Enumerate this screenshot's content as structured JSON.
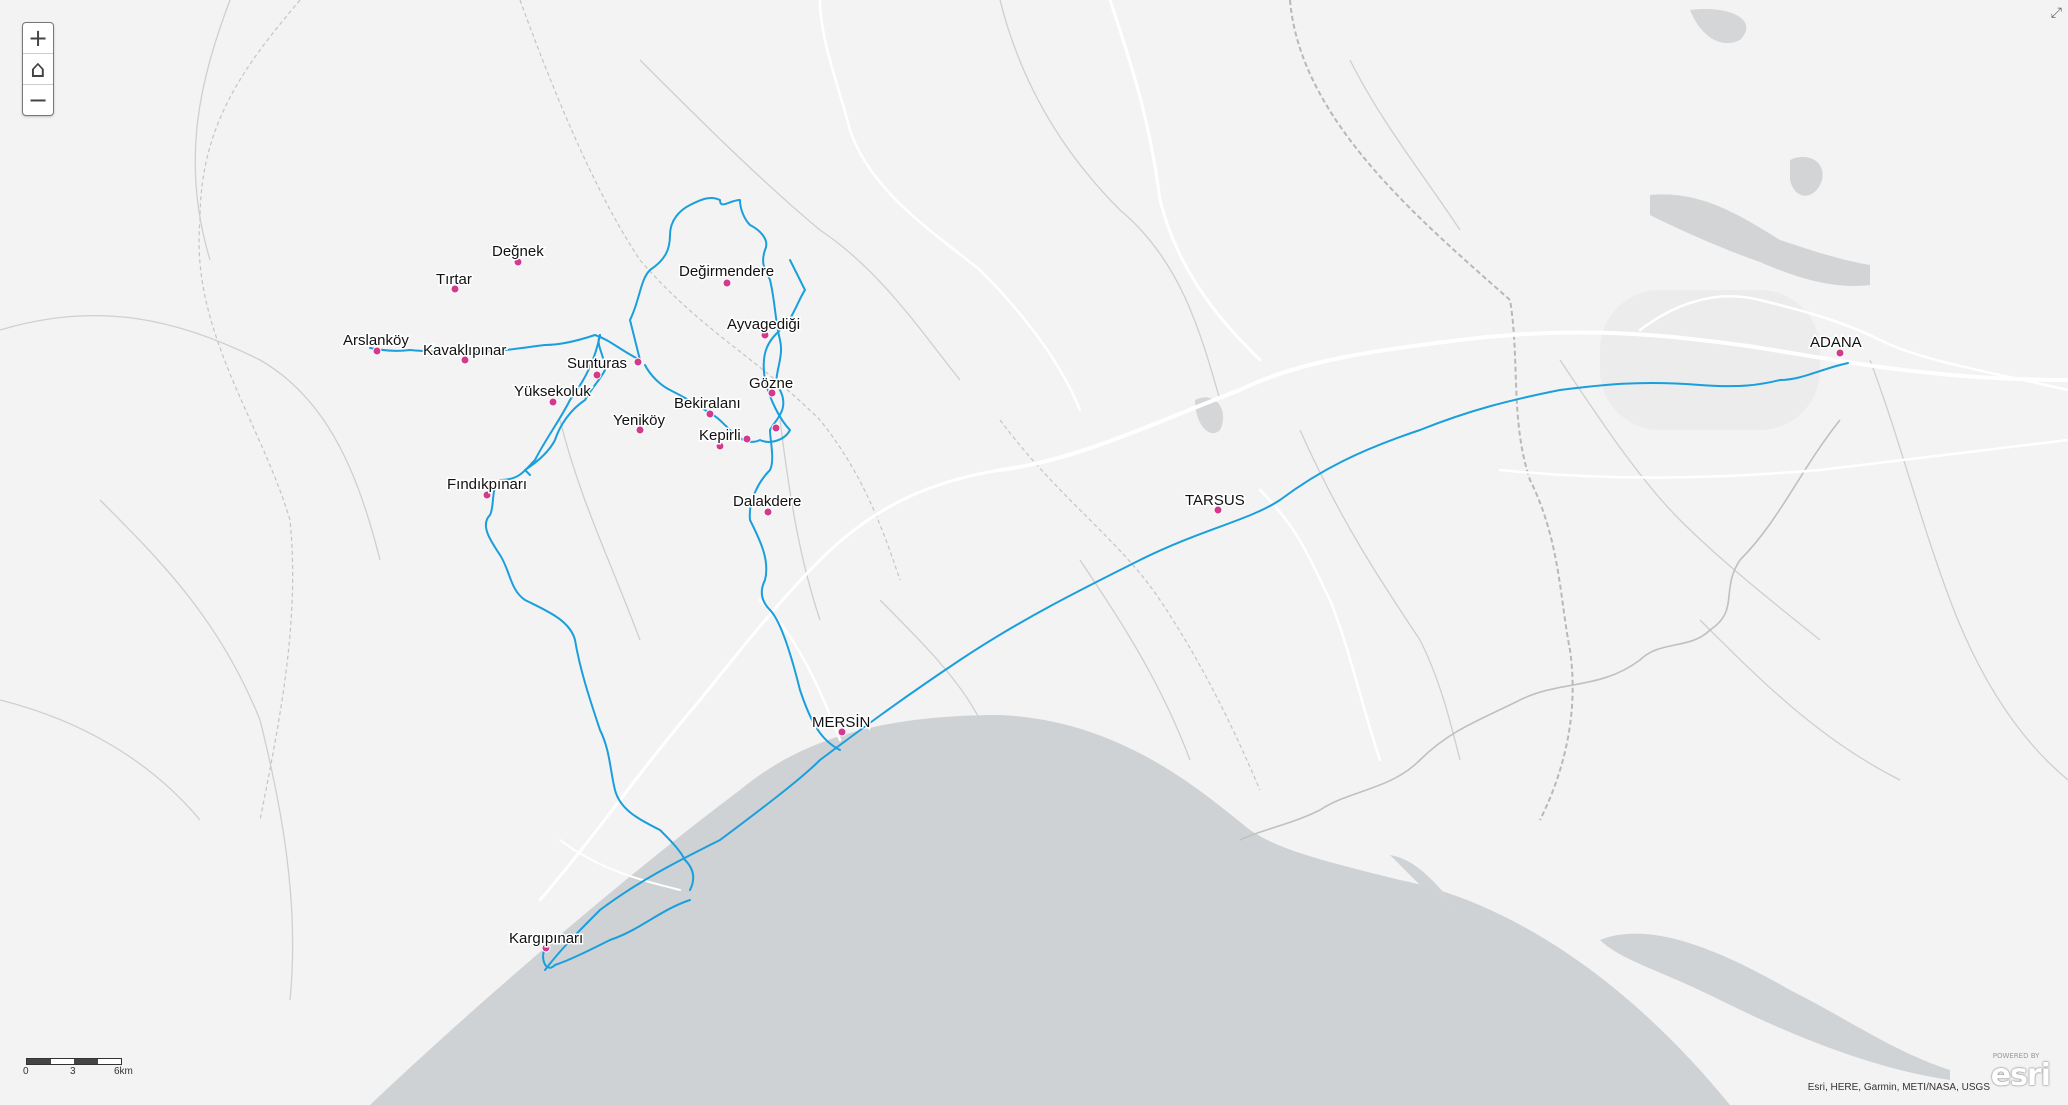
{
  "map": {
    "controls": {
      "zoom_in": "+",
      "home": "⌂",
      "zoom_out": "−"
    },
    "scale_labels": [
      "0",
      "3",
      "6km"
    ],
    "attribution": "Esri, HERE, Garmin, METI/NASA, USGS",
    "logo": {
      "text": "esri",
      "small": "POWERED BY"
    },
    "colors": {
      "route": "#1a9fdc",
      "point": "#d23a8e",
      "land": "#f3f3f3",
      "water": "#cfd2d4",
      "road": "#ffffff",
      "boundary": "#a9a9a9"
    },
    "places": [
      {
        "name": "Değnek"
      },
      {
        "name": "Tırtar"
      },
      {
        "name": "Arslanköy"
      },
      {
        "name": "Kavaklıpınar"
      },
      {
        "name": "Sunturas"
      },
      {
        "name": "Yüksekoluk"
      },
      {
        "name": "Yeniköy"
      },
      {
        "name": "Fındıkpınarı"
      },
      {
        "name": "Değirmendere"
      },
      {
        "name": "Ayvagediği"
      },
      {
        "name": "Gözne"
      },
      {
        "name": "Bekiralanı"
      },
      {
        "name": "Kepirli"
      },
      {
        "name": "Dalakdere"
      },
      {
        "name": "MERSİN"
      },
      {
        "name": "TARSUS"
      },
      {
        "name": "ADANA"
      },
      {
        "name": "Kargıpınarı"
      }
    ]
  }
}
